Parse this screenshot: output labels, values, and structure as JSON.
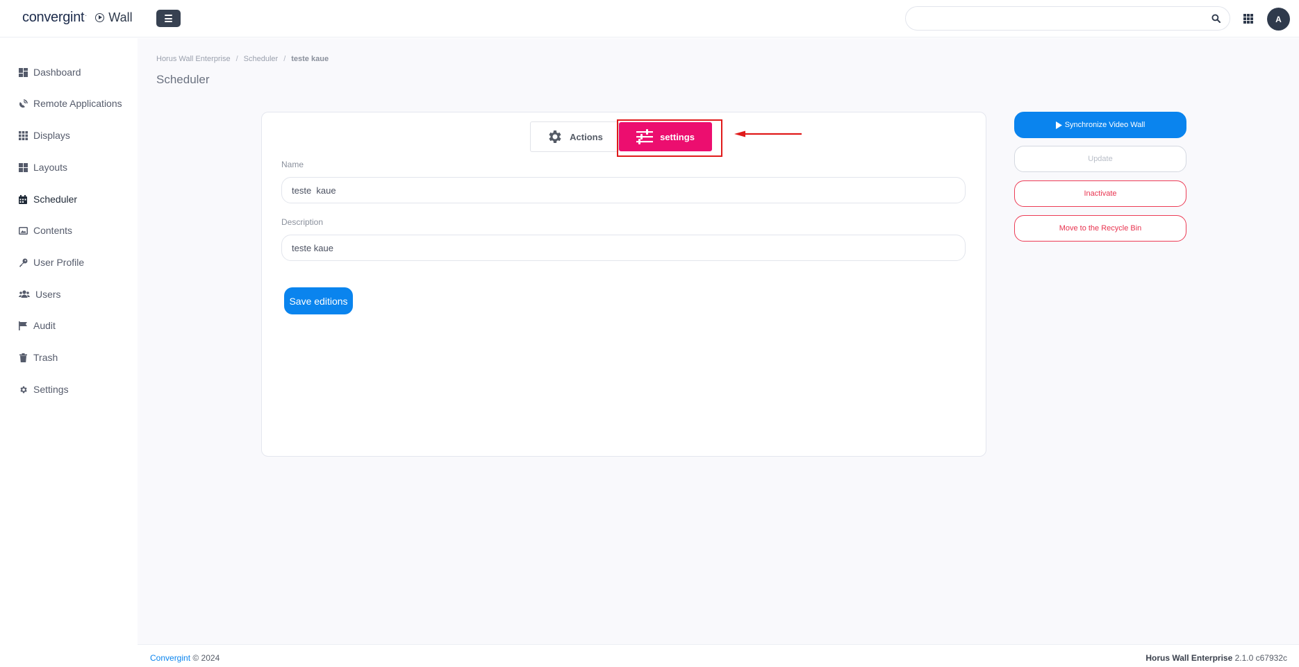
{
  "header": {
    "logo_text": "convergint",
    "logo_mark": "·",
    "product": "Wall",
    "search_placeholder": "",
    "avatar_initial": "A"
  },
  "sidebar": {
    "items": [
      {
        "label": "Dashboard",
        "icon": "dashboard-icon"
      },
      {
        "label": "Remote Applications",
        "icon": "satellite-dish-icon"
      },
      {
        "label": "Displays",
        "icon": "grid-icon"
      },
      {
        "label": "Layouts",
        "icon": "layout-icon"
      },
      {
        "label": "Scheduler",
        "icon": "calendar-icon"
      },
      {
        "label": "Contents",
        "icon": "image-icon"
      },
      {
        "label": "User Profile",
        "icon": "key-icon"
      },
      {
        "label": "Users",
        "icon": "users-icon"
      },
      {
        "label": "Audit",
        "icon": "flag-icon"
      },
      {
        "label": "Trash",
        "icon": "trash-icon"
      },
      {
        "label": "Settings",
        "icon": "gear-icon"
      }
    ],
    "active": "Scheduler"
  },
  "breadcrumb": {
    "items": [
      "Horus Wall Enterprise",
      "Scheduler",
      "teste kaue"
    ],
    "separator": "/"
  },
  "page": {
    "title": "Scheduler"
  },
  "tabs": {
    "actions_label": "Actions",
    "settings_label": "settings",
    "active": "settings",
    "active_color": "#ec0e6f"
  },
  "form": {
    "name_label": "Name",
    "name_value": "teste  kaue",
    "description_label": "Description",
    "description_value": "teste kaue",
    "save_label": "Save editions"
  },
  "actions": {
    "sync_label": "Synchronize Video Wall",
    "update_label": "Update",
    "inactivate_label": "Inactivate",
    "recycle_label": "Move to the Recycle Bin"
  },
  "footer": {
    "brand": "Convergint",
    "copyright": "© 2024",
    "product_name": "Horus Wall Enterprise",
    "version": "2.1.0 c67932c"
  },
  "colors": {
    "primary": "#0a84ee",
    "accent": "#ec0e6f",
    "danger": "#e8334f",
    "annotation": "#e01a1a"
  }
}
